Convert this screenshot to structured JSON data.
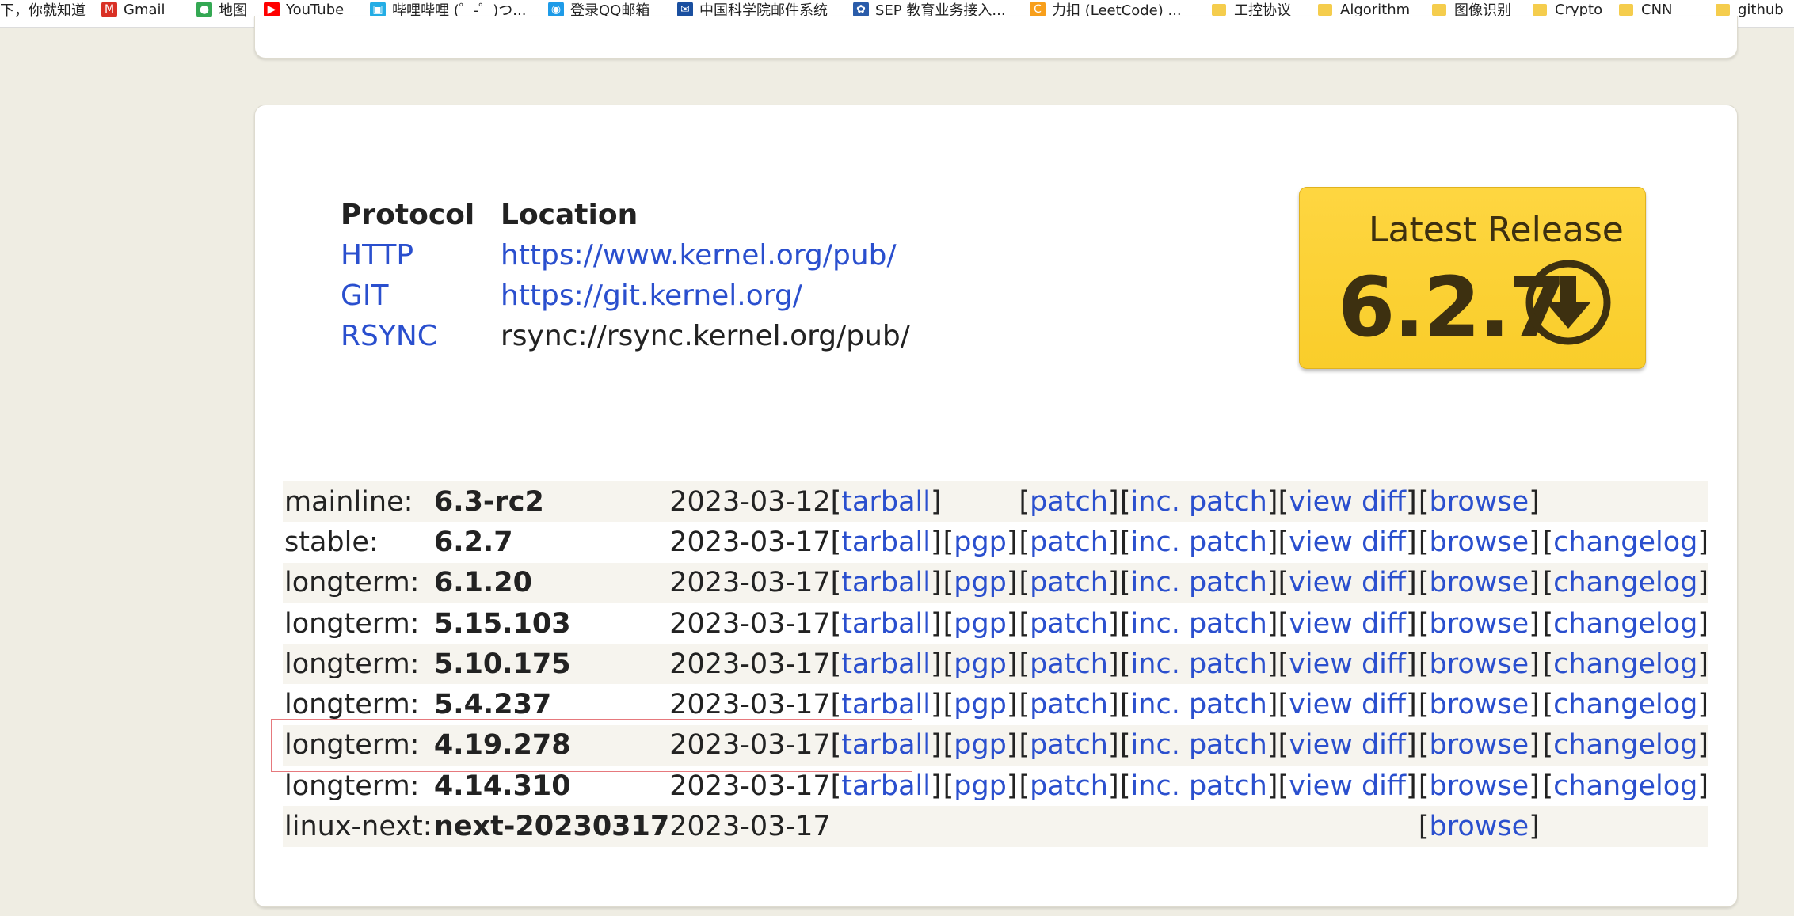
{
  "bookmarks": [
    {
      "label": "下，你就知道",
      "icon": "none"
    },
    {
      "label": "Gmail",
      "icon": "gmail-icon",
      "color": "#d93025"
    },
    {
      "label": "地图",
      "icon": "maps-pin-icon",
      "color": "#34a853"
    },
    {
      "label": "YouTube",
      "icon": "youtube-icon",
      "color": "#ff0000"
    },
    {
      "label": "哔哩哔哩 (゜-゜)つ...",
      "icon": "bilibili-icon",
      "color": "#23ade5"
    },
    {
      "label": "登录QQ邮箱",
      "icon": "qq-mail-icon",
      "color": "#1e9be8"
    },
    {
      "label": "中国科学院邮件系统",
      "icon": "mail-icon",
      "color": "#1a4fa0"
    },
    {
      "label": "SEP 教育业务接入...",
      "icon": "sep-icon",
      "color": "#2a5caa"
    },
    {
      "label": "力扣 (LeetCode) ...",
      "icon": "leetcode-icon",
      "color": "#f89f1b"
    },
    {
      "label": "工控协议",
      "icon": "folder-icon"
    },
    {
      "label": "Algorithm",
      "icon": "folder-icon"
    },
    {
      "label": "图像识别",
      "icon": "folder-icon"
    },
    {
      "label": "Crypto",
      "icon": "folder-icon"
    },
    {
      "label": "CNN",
      "icon": "folder-icon"
    },
    {
      "label": "github",
      "icon": "folder-icon"
    }
  ],
  "protocols": {
    "header_protocol": "Protocol",
    "header_location": "Location",
    "rows": [
      {
        "protocol": "HTTP",
        "location": "https://www.kernel.org/pub/",
        "link": true
      },
      {
        "protocol": "GIT",
        "location": "https://git.kernel.org/",
        "link": true
      },
      {
        "protocol": "RSYNC",
        "location": "rsync://rsync.kernel.org/pub/",
        "link": false
      }
    ]
  },
  "latest_release": {
    "title": "Latest Release",
    "version": "6.2.7",
    "icon": "download-arrow-icon"
  },
  "releases": [
    {
      "kind": "mainline:",
      "version": "6.3-rc2",
      "date": "2023-03-12",
      "tarball": "tarball",
      "pgp": "",
      "patch": "patch",
      "inc_patch": "inc. patch",
      "view_diff": "view diff",
      "browse": "browse",
      "changelog": ""
    },
    {
      "kind": "stable:",
      "version": "6.2.7",
      "date": "2023-03-17",
      "tarball": "tarball",
      "pgp": "pgp",
      "patch": "patch",
      "inc_patch": "inc. patch",
      "view_diff": "view diff",
      "browse": "browse",
      "changelog": "changelog"
    },
    {
      "kind": "longterm:",
      "version": "6.1.20",
      "date": "2023-03-17",
      "tarball": "tarball",
      "pgp": "pgp",
      "patch": "patch",
      "inc_patch": "inc. patch",
      "view_diff": "view diff",
      "browse": "browse",
      "changelog": "changelog"
    },
    {
      "kind": "longterm:",
      "version": "5.15.103",
      "date": "2023-03-17",
      "tarball": "tarball",
      "pgp": "pgp",
      "patch": "patch",
      "inc_patch": "inc. patch",
      "view_diff": "view diff",
      "browse": "browse",
      "changelog": "changelog"
    },
    {
      "kind": "longterm:",
      "version": "5.10.175",
      "date": "2023-03-17",
      "tarball": "tarball",
      "pgp": "pgp",
      "patch": "patch",
      "inc_patch": "inc. patch",
      "view_diff": "view diff",
      "browse": "browse",
      "changelog": "changelog"
    },
    {
      "kind": "longterm:",
      "version": "5.4.237",
      "date": "2023-03-17",
      "tarball": "tarball",
      "pgp": "pgp",
      "patch": "patch",
      "inc_patch": "inc. patch",
      "view_diff": "view diff",
      "browse": "browse",
      "changelog": "changelog"
    },
    {
      "kind": "longterm:",
      "version": "4.19.278",
      "date": "2023-03-17",
      "tarball": "tarball",
      "pgp": "pgp",
      "patch": "patch",
      "inc_patch": "inc. patch",
      "view_diff": "view diff",
      "browse": "browse",
      "changelog": "changelog"
    },
    {
      "kind": "longterm:",
      "version": "4.14.310",
      "date": "2023-03-17",
      "tarball": "tarball",
      "pgp": "pgp",
      "patch": "patch",
      "inc_patch": "inc. patch",
      "view_diff": "view diff",
      "browse": "browse",
      "changelog": "changelog"
    },
    {
      "kind": "linux-next:",
      "version": "next-20230317",
      "date": "2023-03-17",
      "tarball": "",
      "pgp": "",
      "patch": "",
      "inc_patch": "",
      "view_diff": "",
      "browse": "browse",
      "changelog": ""
    }
  ],
  "colors": {
    "link": "#2a4fce",
    "release_box": "#fbd234",
    "page_bg": "#efede3",
    "highlight_border": "#e6797d"
  }
}
